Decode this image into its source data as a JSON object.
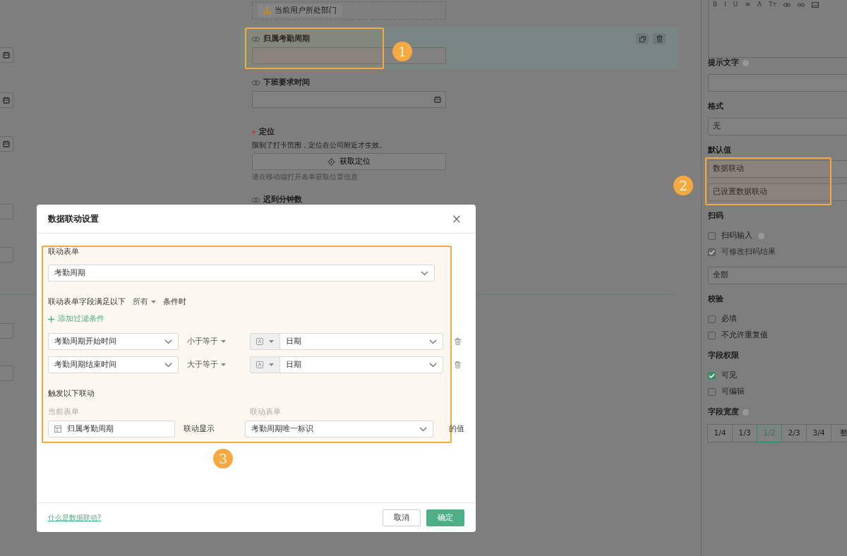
{
  "left_column": {
    "fields": [
      {
        "kind": "date"
      },
      {
        "kind": "date"
      },
      {
        "kind": "date"
      },
      {
        "kind": "text"
      },
      {
        "kind": "text"
      },
      {
        "kind": "text"
      },
      {
        "kind": "text"
      }
    ]
  },
  "canvas": {
    "items": [
      {
        "kind": "dept_tag",
        "label": "当前用户所处部门"
      },
      {
        "kind": "field",
        "label": "归属考勤周期",
        "selected": true
      },
      {
        "kind": "date",
        "label": "下班要求时间",
        "selected": false
      },
      {
        "kind": "location",
        "label": "定位",
        "required": true,
        "selected": false,
        "description": "限制了打卡范围，定位在公司附近才生效。",
        "button": "获取定位",
        "hint": "请在移动端打开表单获取位置信息"
      },
      {
        "kind": "field",
        "label": "迟到分钟数",
        "selected": false
      }
    ]
  },
  "properties": {
    "editor_toolbar": [
      "B",
      "I",
      "U",
      "≡",
      "A",
      "Tт"
    ],
    "sections": [
      {
        "kind": "input",
        "label": "提示文字",
        "help": true
      },
      {
        "kind": "input",
        "label": "格式",
        "value": "无"
      },
      {
        "kind": "default",
        "label": "默认值",
        "mode": "数据联动",
        "status": "已设置数据联动"
      },
      {
        "kind": "checks",
        "label": "扫码",
        "options": [
          {
            "label": "扫码输入",
            "checked": false,
            "help": true
          },
          {
            "label": "可修改扫码结果",
            "checked": true,
            "disabled": true
          }
        ],
        "select": "全部"
      },
      {
        "kind": "checks",
        "label": "校验",
        "options": [
          {
            "label": "必填",
            "checked": false
          },
          {
            "label": "不允许重复值",
            "checked": false
          }
        ]
      },
      {
        "kind": "checks",
        "label": "字段权限",
        "options": [
          {
            "label": "可见",
            "checked": true
          },
          {
            "label": "可编辑",
            "checked": false
          }
        ]
      },
      {
        "kind": "segments",
        "label": "字段宽度",
        "help": true,
        "options": [
          {
            "label": "1/4",
            "selected": false
          },
          {
            "label": "1/3",
            "selected": false
          },
          {
            "label": "1/2",
            "selected": true
          },
          {
            "label": "2/3",
            "selected": false
          },
          {
            "label": "3/4",
            "selected": false
          },
          {
            "label": "整",
            "selected": false
          }
        ]
      }
    ]
  },
  "dialog": {
    "title": "数据联动设置",
    "close": "×",
    "linked_form_label": "联动表单",
    "linked_form": "考勤周期",
    "condition_prefix": "联动表单字段满足以下",
    "match_mode": "所有",
    "condition_suffix": "条件时",
    "add_filter": "添加过滤条件",
    "filters": [
      {
        "field": "考勤周期开始时间",
        "operator": "小于等于",
        "value": "日期"
      },
      {
        "field": "考勤周期结束时间",
        "operator": "大于等于",
        "value": "日期"
      }
    ],
    "trigger_label": "触发以下联动",
    "current_form_label": "当前表单",
    "target_form_label": "联动表单",
    "links": [
      {
        "current_field": "归属考勤周期",
        "action": "联动显示",
        "linked_field": "考勤周期唯一标识",
        "suffix": "的值"
      }
    ],
    "help_link": "什么是数据联动?",
    "buttons": [
      {
        "label": "取消",
        "kind": "secondary"
      },
      {
        "label": "确定",
        "kind": "primary"
      }
    ]
  },
  "annotations": [
    {
      "number": "1"
    },
    {
      "number": "2"
    },
    {
      "number": "3"
    }
  ]
}
